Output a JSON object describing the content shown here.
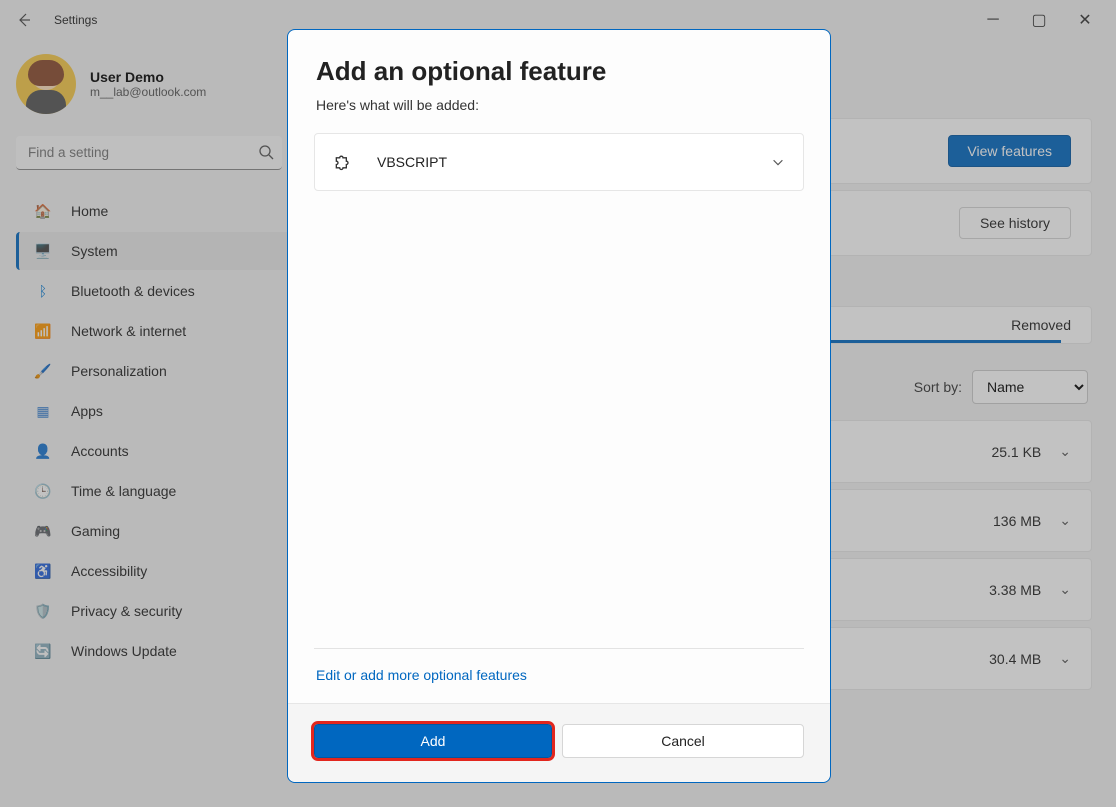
{
  "window": {
    "title": "Settings",
    "min": "─",
    "max": "▢",
    "close": "✕"
  },
  "user": {
    "name": "User Demo",
    "email": "m__lab@outlook.com"
  },
  "search": {
    "placeholder": "Find a setting"
  },
  "nav": {
    "items": [
      {
        "icon": "🏠",
        "label": "Home"
      },
      {
        "icon": "🖥️",
        "label": "System"
      },
      {
        "icon": "ᛒ",
        "label": "Bluetooth & devices"
      },
      {
        "icon": "📶",
        "label": "Network & internet"
      },
      {
        "icon": "🖌️",
        "label": "Personalization"
      },
      {
        "icon": "▦",
        "label": "Apps"
      },
      {
        "icon": "👤",
        "label": "Accounts"
      },
      {
        "icon": "🕒",
        "label": "Time & language"
      },
      {
        "icon": "🎮",
        "label": "Gaming"
      },
      {
        "icon": "♿",
        "label": "Accessibility"
      },
      {
        "icon": "🛡️",
        "label": "Privacy & security"
      },
      {
        "icon": "🔄",
        "label": "Windows Update"
      }
    ],
    "active_index": 1
  },
  "main": {
    "view_features_btn": "View features",
    "see_history_btn": "See history",
    "status_label": "Removed",
    "sort_label": "Sort by:",
    "sort_value": "Name",
    "installed": [
      {
        "size": "25.1 KB"
      },
      {
        "size": "136 MB"
      },
      {
        "size": "3.38 MB"
      },
      {
        "size": "30.4 MB"
      }
    ]
  },
  "modal": {
    "title": "Add an optional feature",
    "subtitle": "Here's what will be added:",
    "feature_name": "VBSCRIPT",
    "edit_link": "Edit or add more optional features",
    "add_btn": "Add",
    "cancel_btn": "Cancel"
  }
}
